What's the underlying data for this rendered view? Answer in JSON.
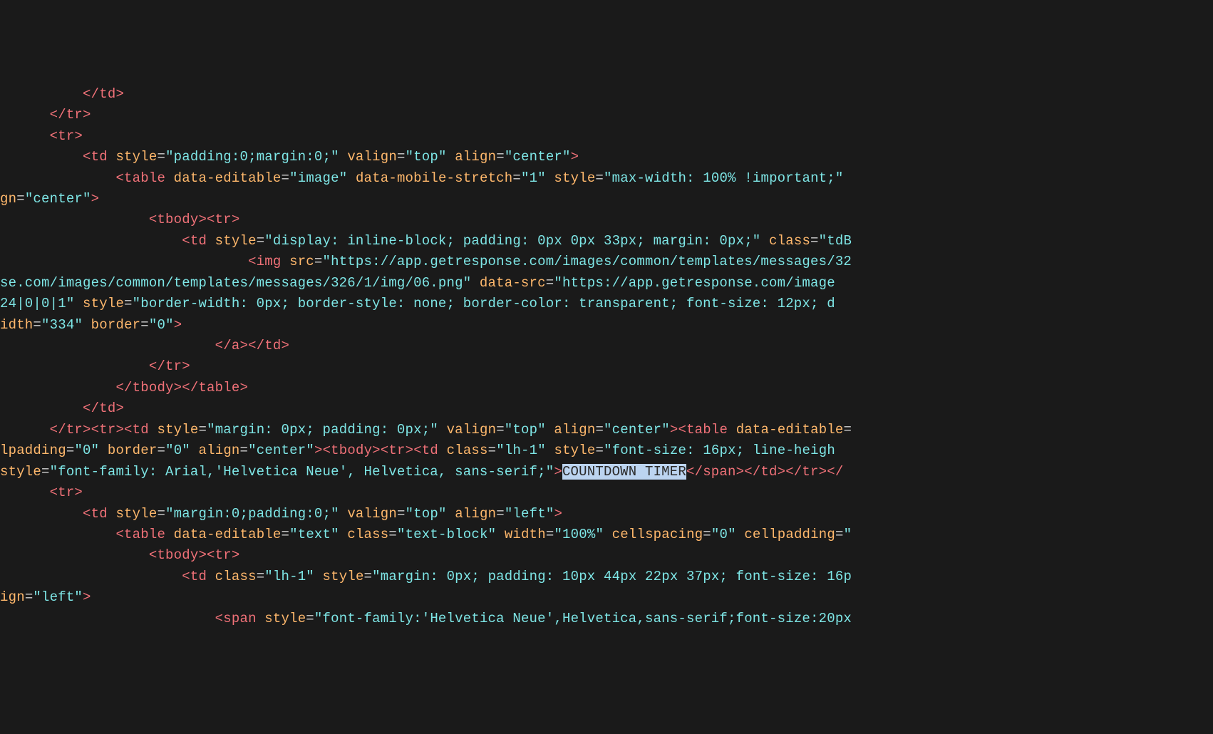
{
  "selection_text": "COUNTDOWN TIMER",
  "lines": [
    [
      {
        "cls": "plain",
        "text": "          "
      },
      {
        "cls": "tag",
        "text": "</td>"
      }
    ],
    [
      {
        "cls": "plain",
        "text": "      "
      },
      {
        "cls": "tag",
        "text": "</tr>"
      }
    ],
    [
      {
        "cls": "plain",
        "text": "      "
      },
      {
        "cls": "tag",
        "text": "<tr>"
      }
    ],
    [
      {
        "cls": "plain",
        "text": "          "
      },
      {
        "cls": "tag",
        "text": "<td"
      },
      {
        "cls": "plain",
        "text": " "
      },
      {
        "cls": "attr",
        "text": "style"
      },
      {
        "cls": "punc",
        "text": "="
      },
      {
        "cls": "str",
        "text": "\"padding:0;margin:0;\""
      },
      {
        "cls": "plain",
        "text": " "
      },
      {
        "cls": "attr",
        "text": "valign"
      },
      {
        "cls": "punc",
        "text": "="
      },
      {
        "cls": "str",
        "text": "\"top\""
      },
      {
        "cls": "plain",
        "text": " "
      },
      {
        "cls": "attr",
        "text": "align"
      },
      {
        "cls": "punc",
        "text": "="
      },
      {
        "cls": "str",
        "text": "\"center\""
      },
      {
        "cls": "tag",
        "text": ">"
      }
    ],
    [
      {
        "cls": "plain",
        "text": "              "
      },
      {
        "cls": "tag",
        "text": "<table"
      },
      {
        "cls": "plain",
        "text": " "
      },
      {
        "cls": "attr",
        "text": "data-editable"
      },
      {
        "cls": "punc",
        "text": "="
      },
      {
        "cls": "str",
        "text": "\"image\""
      },
      {
        "cls": "plain",
        "text": " "
      },
      {
        "cls": "attr",
        "text": "data-mobile-stretch"
      },
      {
        "cls": "punc",
        "text": "="
      },
      {
        "cls": "str",
        "text": "\"1\""
      },
      {
        "cls": "plain",
        "text": " "
      },
      {
        "cls": "attr",
        "text": "style"
      },
      {
        "cls": "punc",
        "text": "="
      },
      {
        "cls": "str",
        "text": "\"max-width: 100% !important;\""
      },
      {
        "cls": "plain",
        "text": " "
      }
    ],
    [
      {
        "cls": "attr",
        "text": "gn"
      },
      {
        "cls": "punc",
        "text": "="
      },
      {
        "cls": "str",
        "text": "\"center\""
      },
      {
        "cls": "tag",
        "text": ">"
      }
    ],
    [
      {
        "cls": "plain",
        "text": "                  "
      },
      {
        "cls": "tag",
        "text": "<tbody><tr>"
      }
    ],
    [
      {
        "cls": "plain",
        "text": "                      "
      },
      {
        "cls": "tag",
        "text": "<td"
      },
      {
        "cls": "plain",
        "text": " "
      },
      {
        "cls": "attr",
        "text": "style"
      },
      {
        "cls": "punc",
        "text": "="
      },
      {
        "cls": "str",
        "text": "\"display: inline-block; padding: 0px 0px 33px; margin: 0px;\""
      },
      {
        "cls": "plain",
        "text": " "
      },
      {
        "cls": "attr",
        "text": "class"
      },
      {
        "cls": "punc",
        "text": "="
      },
      {
        "cls": "str",
        "text": "\"tdB"
      }
    ],
    [
      {
        "cls": "plain",
        "text": "                              "
      },
      {
        "cls": "tag",
        "text": "<img"
      },
      {
        "cls": "plain",
        "text": " "
      },
      {
        "cls": "attr",
        "text": "src"
      },
      {
        "cls": "punc",
        "text": "="
      },
      {
        "cls": "str",
        "text": "\"https://app.getresponse.com/images/common/templates/messages/32"
      }
    ],
    [
      {
        "cls": "str",
        "text": "se.com/images/common/templates/messages/326/1/img/06.png\""
      },
      {
        "cls": "plain",
        "text": " "
      },
      {
        "cls": "attr",
        "text": "data-src"
      },
      {
        "cls": "punc",
        "text": "="
      },
      {
        "cls": "str",
        "text": "\"https://app.getresponse.com/image"
      }
    ],
    [
      {
        "cls": "str",
        "text": "24|0|0|1\""
      },
      {
        "cls": "plain",
        "text": " "
      },
      {
        "cls": "attr",
        "text": "style"
      },
      {
        "cls": "punc",
        "text": "="
      },
      {
        "cls": "str",
        "text": "\"border-width: 0px; border-style: none; border-color: transparent; font-size: 12px; d"
      }
    ],
    [
      {
        "cls": "attr",
        "text": "idth"
      },
      {
        "cls": "punc",
        "text": "="
      },
      {
        "cls": "str",
        "text": "\"334\""
      },
      {
        "cls": "plain",
        "text": " "
      },
      {
        "cls": "attr",
        "text": "border"
      },
      {
        "cls": "punc",
        "text": "="
      },
      {
        "cls": "str",
        "text": "\"0\""
      },
      {
        "cls": "tag",
        "text": ">"
      }
    ],
    [
      {
        "cls": "plain",
        "text": "                          "
      },
      {
        "cls": "tag",
        "text": "</a></td>"
      }
    ],
    [
      {
        "cls": "plain",
        "text": "                  "
      },
      {
        "cls": "tag",
        "text": "</tr>"
      }
    ],
    [
      {
        "cls": "plain",
        "text": "              "
      },
      {
        "cls": "tag",
        "text": "</tbody></table>"
      }
    ],
    [
      {
        "cls": "plain",
        "text": "          "
      },
      {
        "cls": "tag",
        "text": "</td>"
      }
    ],
    [
      {
        "cls": "plain",
        "text": "      "
      },
      {
        "cls": "tag",
        "text": "</tr><tr><td"
      },
      {
        "cls": "plain",
        "text": " "
      },
      {
        "cls": "attr",
        "text": "style"
      },
      {
        "cls": "punc",
        "text": "="
      },
      {
        "cls": "str",
        "text": "\"margin: 0px; padding: 0px;\""
      },
      {
        "cls": "plain",
        "text": " "
      },
      {
        "cls": "attr",
        "text": "valign"
      },
      {
        "cls": "punc",
        "text": "="
      },
      {
        "cls": "str",
        "text": "\"top\""
      },
      {
        "cls": "plain",
        "text": " "
      },
      {
        "cls": "attr",
        "text": "align"
      },
      {
        "cls": "punc",
        "text": "="
      },
      {
        "cls": "str",
        "text": "\"center\""
      },
      {
        "cls": "tag",
        "text": "><table"
      },
      {
        "cls": "plain",
        "text": " "
      },
      {
        "cls": "attr",
        "text": "data-editable"
      },
      {
        "cls": "punc",
        "text": "="
      }
    ],
    [
      {
        "cls": "attr",
        "text": "lpadding"
      },
      {
        "cls": "punc",
        "text": "="
      },
      {
        "cls": "str",
        "text": "\"0\""
      },
      {
        "cls": "plain",
        "text": " "
      },
      {
        "cls": "attr",
        "text": "border"
      },
      {
        "cls": "punc",
        "text": "="
      },
      {
        "cls": "str",
        "text": "\"0\""
      },
      {
        "cls": "plain",
        "text": " "
      },
      {
        "cls": "attr",
        "text": "align"
      },
      {
        "cls": "punc",
        "text": "="
      },
      {
        "cls": "str",
        "text": "\"center\""
      },
      {
        "cls": "tag",
        "text": "><tbody><tr><td"
      },
      {
        "cls": "plain",
        "text": " "
      },
      {
        "cls": "attr",
        "text": "class"
      },
      {
        "cls": "punc",
        "text": "="
      },
      {
        "cls": "str",
        "text": "\"lh-1\""
      },
      {
        "cls": "plain",
        "text": " "
      },
      {
        "cls": "attr",
        "text": "style"
      },
      {
        "cls": "punc",
        "text": "="
      },
      {
        "cls": "str",
        "text": "\"font-size: 16px; line-heigh"
      }
    ],
    [
      {
        "cls": "attr",
        "text": "style"
      },
      {
        "cls": "punc",
        "text": "="
      },
      {
        "cls": "str",
        "text": "\"font-family: Arial,'Helvetica Neue', Helvetica, sans-serif;\""
      },
      {
        "cls": "tag",
        "text": ">"
      },
      {
        "cls": "sel",
        "text": "COUNTDOWN TIMER"
      },
      {
        "cls": "tag",
        "text": "</span></td></tr></"
      }
    ],
    [
      {
        "cls": "plain",
        "text": "      "
      },
      {
        "cls": "tag",
        "text": "<tr>"
      }
    ],
    [
      {
        "cls": "plain",
        "text": "          "
      },
      {
        "cls": "tag",
        "text": "<td"
      },
      {
        "cls": "plain",
        "text": " "
      },
      {
        "cls": "attr",
        "text": "style"
      },
      {
        "cls": "punc",
        "text": "="
      },
      {
        "cls": "str",
        "text": "\"margin:0;padding:0;\""
      },
      {
        "cls": "plain",
        "text": " "
      },
      {
        "cls": "attr",
        "text": "valign"
      },
      {
        "cls": "punc",
        "text": "="
      },
      {
        "cls": "str",
        "text": "\"top\""
      },
      {
        "cls": "plain",
        "text": " "
      },
      {
        "cls": "attr",
        "text": "align"
      },
      {
        "cls": "punc",
        "text": "="
      },
      {
        "cls": "str",
        "text": "\"left\""
      },
      {
        "cls": "tag",
        "text": ">"
      }
    ],
    [
      {
        "cls": "plain",
        "text": "              "
      },
      {
        "cls": "tag",
        "text": "<table"
      },
      {
        "cls": "plain",
        "text": " "
      },
      {
        "cls": "attr",
        "text": "data-editable"
      },
      {
        "cls": "punc",
        "text": "="
      },
      {
        "cls": "str",
        "text": "\"text\""
      },
      {
        "cls": "plain",
        "text": " "
      },
      {
        "cls": "attr",
        "text": "class"
      },
      {
        "cls": "punc",
        "text": "="
      },
      {
        "cls": "str",
        "text": "\"text-block\""
      },
      {
        "cls": "plain",
        "text": " "
      },
      {
        "cls": "attr",
        "text": "width"
      },
      {
        "cls": "punc",
        "text": "="
      },
      {
        "cls": "str",
        "text": "\"100%\""
      },
      {
        "cls": "plain",
        "text": " "
      },
      {
        "cls": "attr",
        "text": "cellspacing"
      },
      {
        "cls": "punc",
        "text": "="
      },
      {
        "cls": "str",
        "text": "\"0\""
      },
      {
        "cls": "plain",
        "text": " "
      },
      {
        "cls": "attr",
        "text": "cellpadding"
      },
      {
        "cls": "punc",
        "text": "="
      },
      {
        "cls": "str",
        "text": "\""
      }
    ],
    [
      {
        "cls": "plain",
        "text": "                  "
      },
      {
        "cls": "tag",
        "text": "<tbody><tr>"
      }
    ],
    [
      {
        "cls": "plain",
        "text": "                      "
      },
      {
        "cls": "tag",
        "text": "<td"
      },
      {
        "cls": "plain",
        "text": " "
      },
      {
        "cls": "attr",
        "text": "class"
      },
      {
        "cls": "punc",
        "text": "="
      },
      {
        "cls": "str",
        "text": "\"lh-1\""
      },
      {
        "cls": "plain",
        "text": " "
      },
      {
        "cls": "attr",
        "text": "style"
      },
      {
        "cls": "punc",
        "text": "="
      },
      {
        "cls": "str",
        "text": "\"margin: 0px; padding: 10px 44px 22px 37px; font-size: 16p"
      }
    ],
    [
      {
        "cls": "attr",
        "text": "ign"
      },
      {
        "cls": "punc",
        "text": "="
      },
      {
        "cls": "str",
        "text": "\"left\""
      },
      {
        "cls": "tag",
        "text": ">"
      }
    ],
    [
      {
        "cls": "plain",
        "text": "                          "
      },
      {
        "cls": "tag",
        "text": "<span"
      },
      {
        "cls": "plain",
        "text": " "
      },
      {
        "cls": "attr",
        "text": "style"
      },
      {
        "cls": "punc",
        "text": "="
      },
      {
        "cls": "str",
        "text": "\"font-family:'Helvetica Neue',Helvetica,sans-serif;font-size:20px"
      }
    ]
  ]
}
